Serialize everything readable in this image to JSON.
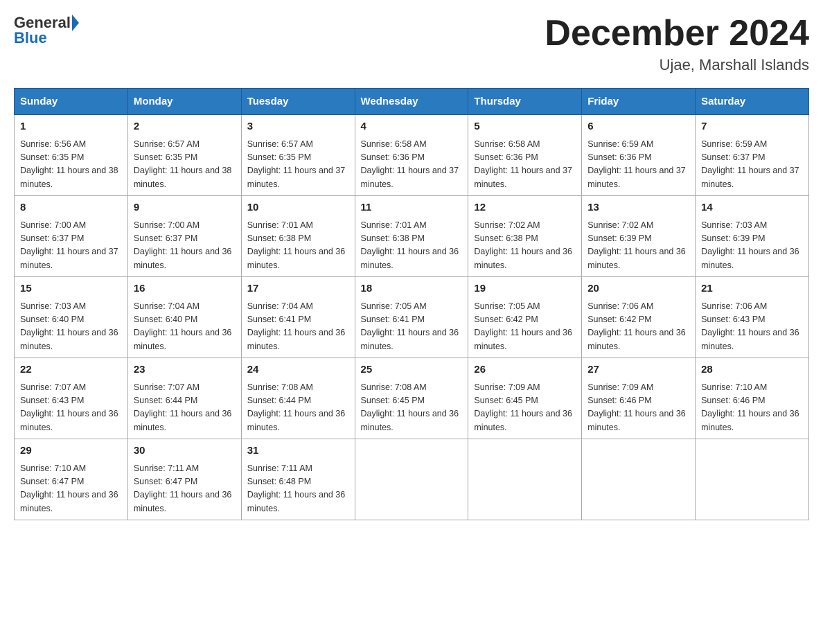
{
  "logo": {
    "text1": "General",
    "text2": "Blue"
  },
  "title": "December 2024",
  "subtitle": "Ujae, Marshall Islands",
  "days_of_week": [
    "Sunday",
    "Monday",
    "Tuesday",
    "Wednesday",
    "Thursday",
    "Friday",
    "Saturday"
  ],
  "weeks": [
    [
      {
        "day": "1",
        "sunrise": "6:56 AM",
        "sunset": "6:35 PM",
        "daylight": "11 hours and 38 minutes."
      },
      {
        "day": "2",
        "sunrise": "6:57 AM",
        "sunset": "6:35 PM",
        "daylight": "11 hours and 38 minutes."
      },
      {
        "day": "3",
        "sunrise": "6:57 AM",
        "sunset": "6:35 PM",
        "daylight": "11 hours and 37 minutes."
      },
      {
        "day": "4",
        "sunrise": "6:58 AM",
        "sunset": "6:36 PM",
        "daylight": "11 hours and 37 minutes."
      },
      {
        "day": "5",
        "sunrise": "6:58 AM",
        "sunset": "6:36 PM",
        "daylight": "11 hours and 37 minutes."
      },
      {
        "day": "6",
        "sunrise": "6:59 AM",
        "sunset": "6:36 PM",
        "daylight": "11 hours and 37 minutes."
      },
      {
        "day": "7",
        "sunrise": "6:59 AM",
        "sunset": "6:37 PM",
        "daylight": "11 hours and 37 minutes."
      }
    ],
    [
      {
        "day": "8",
        "sunrise": "7:00 AM",
        "sunset": "6:37 PM",
        "daylight": "11 hours and 37 minutes."
      },
      {
        "day": "9",
        "sunrise": "7:00 AM",
        "sunset": "6:37 PM",
        "daylight": "11 hours and 36 minutes."
      },
      {
        "day": "10",
        "sunrise": "7:01 AM",
        "sunset": "6:38 PM",
        "daylight": "11 hours and 36 minutes."
      },
      {
        "day": "11",
        "sunrise": "7:01 AM",
        "sunset": "6:38 PM",
        "daylight": "11 hours and 36 minutes."
      },
      {
        "day": "12",
        "sunrise": "7:02 AM",
        "sunset": "6:38 PM",
        "daylight": "11 hours and 36 minutes."
      },
      {
        "day": "13",
        "sunrise": "7:02 AM",
        "sunset": "6:39 PM",
        "daylight": "11 hours and 36 minutes."
      },
      {
        "day": "14",
        "sunrise": "7:03 AM",
        "sunset": "6:39 PM",
        "daylight": "11 hours and 36 minutes."
      }
    ],
    [
      {
        "day": "15",
        "sunrise": "7:03 AM",
        "sunset": "6:40 PM",
        "daylight": "11 hours and 36 minutes."
      },
      {
        "day": "16",
        "sunrise": "7:04 AM",
        "sunset": "6:40 PM",
        "daylight": "11 hours and 36 minutes."
      },
      {
        "day": "17",
        "sunrise": "7:04 AM",
        "sunset": "6:41 PM",
        "daylight": "11 hours and 36 minutes."
      },
      {
        "day": "18",
        "sunrise": "7:05 AM",
        "sunset": "6:41 PM",
        "daylight": "11 hours and 36 minutes."
      },
      {
        "day": "19",
        "sunrise": "7:05 AM",
        "sunset": "6:42 PM",
        "daylight": "11 hours and 36 minutes."
      },
      {
        "day": "20",
        "sunrise": "7:06 AM",
        "sunset": "6:42 PM",
        "daylight": "11 hours and 36 minutes."
      },
      {
        "day": "21",
        "sunrise": "7:06 AM",
        "sunset": "6:43 PM",
        "daylight": "11 hours and 36 minutes."
      }
    ],
    [
      {
        "day": "22",
        "sunrise": "7:07 AM",
        "sunset": "6:43 PM",
        "daylight": "11 hours and 36 minutes."
      },
      {
        "day": "23",
        "sunrise": "7:07 AM",
        "sunset": "6:44 PM",
        "daylight": "11 hours and 36 minutes."
      },
      {
        "day": "24",
        "sunrise": "7:08 AM",
        "sunset": "6:44 PM",
        "daylight": "11 hours and 36 minutes."
      },
      {
        "day": "25",
        "sunrise": "7:08 AM",
        "sunset": "6:45 PM",
        "daylight": "11 hours and 36 minutes."
      },
      {
        "day": "26",
        "sunrise": "7:09 AM",
        "sunset": "6:45 PM",
        "daylight": "11 hours and 36 minutes."
      },
      {
        "day": "27",
        "sunrise": "7:09 AM",
        "sunset": "6:46 PM",
        "daylight": "11 hours and 36 minutes."
      },
      {
        "day": "28",
        "sunrise": "7:10 AM",
        "sunset": "6:46 PM",
        "daylight": "11 hours and 36 minutes."
      }
    ],
    [
      {
        "day": "29",
        "sunrise": "7:10 AM",
        "sunset": "6:47 PM",
        "daylight": "11 hours and 36 minutes."
      },
      {
        "day": "30",
        "sunrise": "7:11 AM",
        "sunset": "6:47 PM",
        "daylight": "11 hours and 36 minutes."
      },
      {
        "day": "31",
        "sunrise": "7:11 AM",
        "sunset": "6:48 PM",
        "daylight": "11 hours and 36 minutes."
      },
      null,
      null,
      null,
      null
    ]
  ]
}
